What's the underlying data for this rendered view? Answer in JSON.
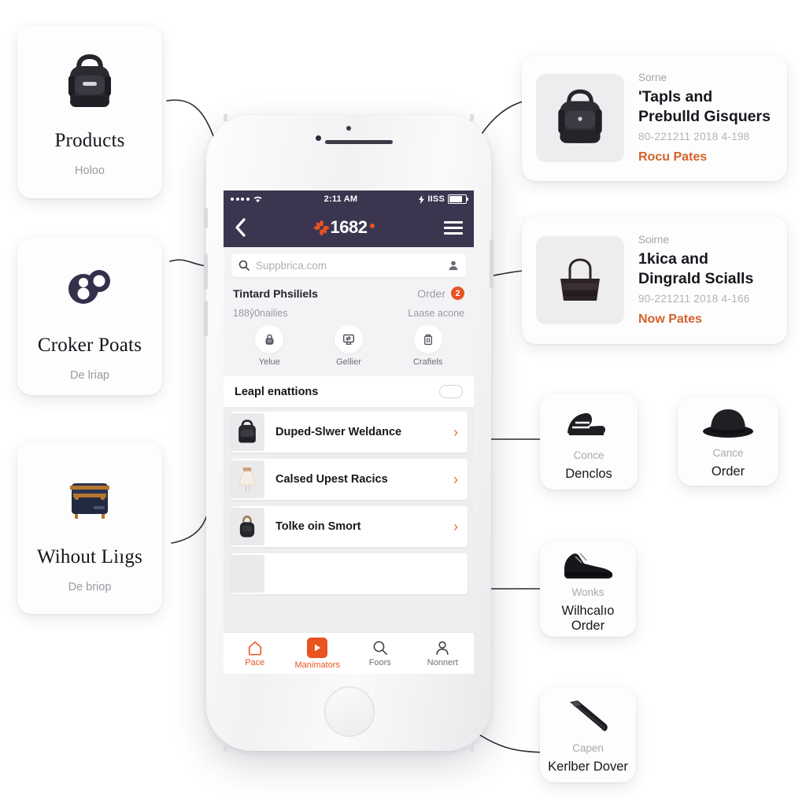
{
  "left_cards": [
    {
      "title": "Products",
      "subtitle": "Holoo",
      "icon": "backpack-icon"
    },
    {
      "title": "Croker Poats",
      "subtitle": "De lriap",
      "icon": "rings-icon"
    },
    {
      "title": "Wihout Liıgs",
      "subtitle": "De briop",
      "icon": "satchel-icon"
    }
  ],
  "right_cards": [
    {
      "kicker": "Sorne",
      "title": "'Tapls and Prebulld Gisquers",
      "meta": "80-221211 2018 4-198",
      "link": "Rocu Pates",
      "icon": "backpack-icon"
    },
    {
      "kicker": "Soirne",
      "title": "1kica and Dingrald Scialls",
      "meta": "90-221211 2018 4-166",
      "link": "Now Pates",
      "icon": "tote-bag-icon"
    }
  ],
  "small_cards": [
    {
      "kicker": "Conce",
      "title": "Denclos",
      "icon": "sandal-heel-icon"
    },
    {
      "kicker": "Cance",
      "title": "Order",
      "icon": "fedora-hat-icon"
    },
    {
      "kicker": "Wonks",
      "title": "Wilhcalıo Order",
      "icon": "sneaker-icon"
    },
    {
      "kicker": "Capen",
      "title": "Kerlber Dover",
      "icon": "pen-icon"
    }
  ],
  "phone": {
    "status_bar": {
      "signal_dots": 4,
      "wifi": "wifi-icon",
      "time": "2:11 AM",
      "bolt": "charging-bolt-icon",
      "carrier_right": "IISS",
      "battery": "battery-icon"
    },
    "app_bar": {
      "back": "chevron-left-icon",
      "brand": "1682",
      "brand_mark": "asterisk-flower-icon",
      "menu": "hamburger-icon"
    },
    "search": {
      "icon": "search-icon",
      "placeholder": "Suppbrica.com",
      "account_icon": "person-icon"
    },
    "section": {
      "title": "Tintard Phsiliels",
      "action": "Order",
      "badge": "2"
    },
    "stats": {
      "left": "188ŷ0nailies",
      "right": "Laase acone"
    },
    "quick_actions": [
      {
        "label": "Yelue",
        "icon": "bag-icon"
      },
      {
        "label": "Gellier",
        "icon": "message-screen-icon"
      },
      {
        "label": "Crafiels",
        "icon": "trash-icon"
      }
    ],
    "toggle_row": {
      "label": "Leapl enattions",
      "state": "off"
    },
    "list_items": [
      {
        "title": "Duped-Slwer Weldance",
        "thumb": "black-backpack-thumb",
        "chevron": "chevron-right-icon"
      },
      {
        "title": "Calsed Upest Racics",
        "thumb": "skirt-thumb",
        "chevron": "chevron-right-icon"
      },
      {
        "title": "Tolke oin Smort",
        "thumb": "mini-bag-thumb",
        "chevron": "chevron-right-icon"
      }
    ],
    "tabs": [
      {
        "label": "Pace",
        "icon": "home-icon",
        "active": true
      },
      {
        "label": "Manimators",
        "icon": "play-square-icon",
        "active": true
      },
      {
        "label": "Foors",
        "icon": "search-icon",
        "active": false
      },
      {
        "label": "Nonnert",
        "icon": "person-icon",
        "active": false
      }
    ]
  },
  "colors": {
    "accent_orange": "#e8531f",
    "link_orange": "#d4622a",
    "header_purple": "#3c3550",
    "page_bg": "#ffffff",
    "card_bg": "#fdfdfd",
    "screen_bg": "#eeeef0"
  }
}
